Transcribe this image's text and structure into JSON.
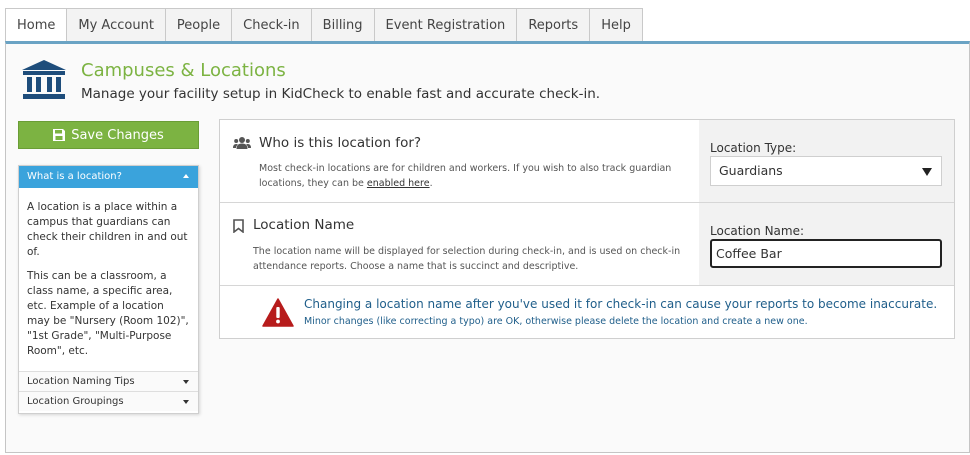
{
  "nav": {
    "tabs": [
      {
        "label": "Home"
      },
      {
        "label": "My Account"
      },
      {
        "label": "People"
      },
      {
        "label": "Check-in"
      },
      {
        "label": "Billing"
      },
      {
        "label": "Event Registration"
      },
      {
        "label": "Reports"
      },
      {
        "label": "Help"
      }
    ]
  },
  "header": {
    "title": "Campuses & Locations",
    "subtitle": "Manage your facility setup in KidCheck to enable fast and accurate check-in.",
    "icon": "building-columns-icon"
  },
  "toolbar": {
    "save_label": "Save Changes",
    "save_icon": "floppy-disk-icon"
  },
  "help": {
    "active_title": "What is a location?",
    "paragraph1": "A location is a place within a campus that guardians can check their children in and out of.",
    "paragraph2": "This can be a classroom, a class name, a specific area, etc. Example of a location may be \"Nursery (Room 102)\", \"1st Grade\", \"Multi-Purpose Room\", etc.",
    "items": [
      {
        "label": "Location Naming Tips"
      },
      {
        "label": "Location Groupings"
      }
    ]
  },
  "sections": {
    "who": {
      "icon": "users-icon",
      "title": "Who is this location for?",
      "desc_before": "Most check-in locations are for children and workers. If you wish to also track guardian locations, they can be ",
      "desc_link": "enabled here",
      "desc_after": ".",
      "field_label": "Location Type:",
      "selected": "Guardians"
    },
    "name": {
      "icon": "bookmark-icon",
      "title": "Location Name",
      "desc": "The location name will be displayed for selection during check-in, and is used on check-in attendance reports. Choose a name that is succinct and descriptive.",
      "field_label": "Location Name:",
      "value": "Coffee Bar"
    },
    "warning": {
      "icon": "warning-icon",
      "title": "Changing a location name after you've used it for check-in can cause your reports to become inaccurate.",
      "subtitle": "Minor changes (like correcting a typo) are OK, otherwise please delete the location and create a new one."
    }
  },
  "colors": {
    "brand_green": "#7cb342",
    "accent_blue": "#3aa3dc",
    "warning_red": "#b71c1c",
    "warning_text": "#1f5e8a",
    "icon_navy": "#1e4d7b"
  }
}
